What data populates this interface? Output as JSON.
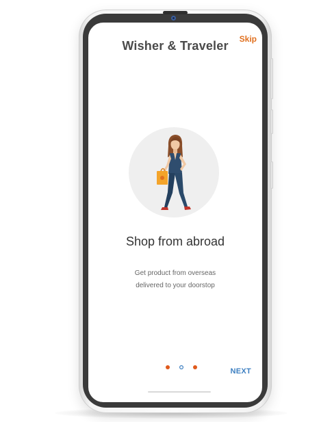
{
  "header": {
    "title": "Wisher & Traveler",
    "skip_label": "Skip"
  },
  "onboarding": {
    "illustration_icon": "woman-with-shopping-bag-illustration",
    "heading": "Shop from abroad",
    "description_lines": [
      "Get product from overseas",
      "delivered to your doorstop"
    ],
    "page_indicator": {
      "total": 3,
      "current": 2
    },
    "next_label": "NEXT"
  },
  "colors": {
    "title": "#4a4a4a",
    "skip": "#e0701f",
    "next": "#3d7fc1",
    "dot_filled": "#e05a1c",
    "dot_active_outline": "#3d7fc1",
    "illustration_circle": "#efefef"
  }
}
